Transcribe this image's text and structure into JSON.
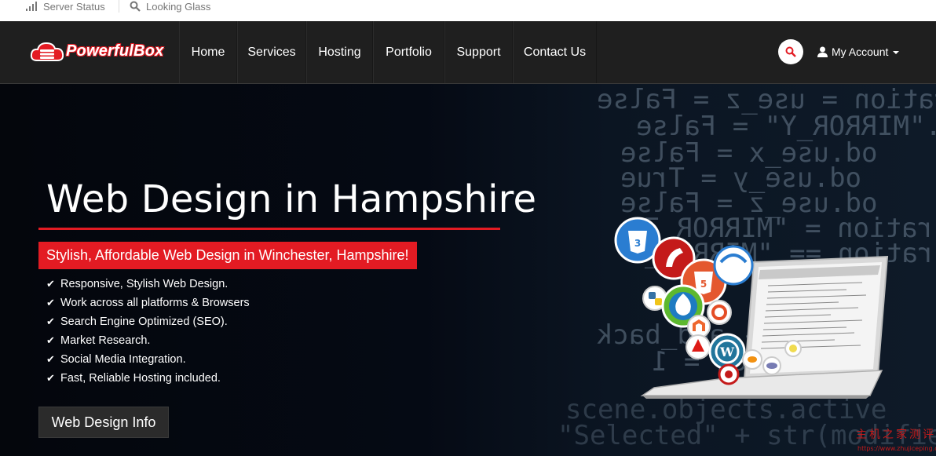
{
  "topbar": {
    "server_status": "Server Status",
    "looking_glass": "Looking Glass"
  },
  "brand": {
    "name": "PowerfulBox",
    "accent": "#e31b23"
  },
  "nav": {
    "items": [
      "Home",
      "Services",
      "Hosting",
      "Portfolio",
      "Support",
      "Contact Us"
    ],
    "account_label": "My Account"
  },
  "hero": {
    "title": "Web Design in Hampshire",
    "tagline": "Stylish, Affordable Web Design in Winchester, Hampshire!",
    "features": [
      "Responsive, Stylish Web Design.",
      "Work across all platforms & Browsers",
      "Search Engine Optimized (SEO).",
      "Market Research.",
      "Social Media Integration.",
      "Fast, Reliable Hosting included."
    ],
    "cta_label": "Web Design Info",
    "code_lines": [
      "ration = use_z = False",
      "r.\"MIRROR_Y\" = False",
      "od.use_x = False",
      "od.use_y = True",
      "od.use_z = False",
      "ration = \"MIRROR_Z\"",
      "ration == \"MIRROR_Y\"",
      "  - add_back",
      "select = 1",
      "scene.objects.active",
      "\"Selected\" + str(modifier"
    ],
    "badges": [
      "CSS",
      "RAILS",
      "HTML",
      "NET"
    ]
  },
  "watermark": {
    "text": "主机之家测评",
    "url": "https://www.zhujiceping.com"
  }
}
